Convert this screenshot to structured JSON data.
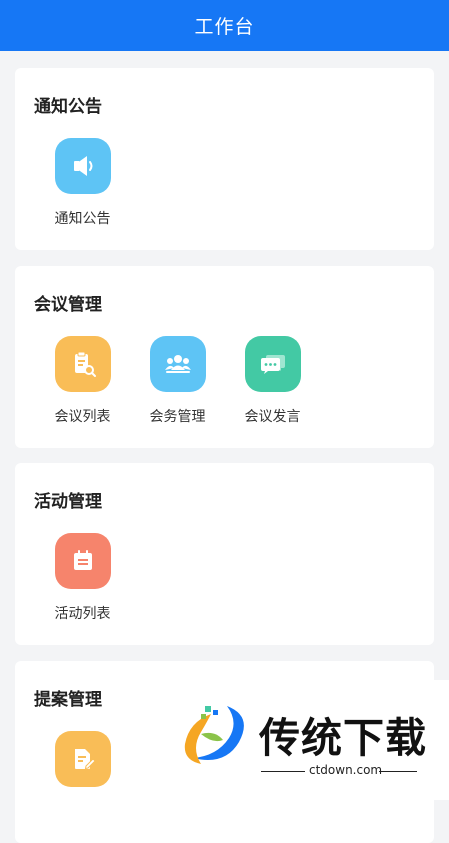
{
  "header": {
    "title": "工作台"
  },
  "sections": [
    {
      "title": "通知公告",
      "items": [
        {
          "label": "通知公告",
          "icon": "speaker-icon",
          "color": "#5ec4f5"
        }
      ]
    },
    {
      "title": "会议管理",
      "items": [
        {
          "label": "会议列表",
          "icon": "clipboard-search-icon",
          "color": "#f9bd57"
        },
        {
          "label": "会务管理",
          "icon": "group-icon",
          "color": "#5ec4f5"
        },
        {
          "label": "会议发言",
          "icon": "chat-bubble-icon",
          "color": "#43c9a4"
        }
      ]
    },
    {
      "title": "活动管理",
      "items": [
        {
          "label": "活动列表",
          "icon": "calendar-icon",
          "color": "#f6846c"
        }
      ]
    },
    {
      "title": "提案管理",
      "items": [
        {
          "label": "",
          "icon": "document-edit-icon",
          "color": "#f9bd57"
        }
      ]
    }
  ],
  "watermark": {
    "brand": "传统下载",
    "url": "ctdown.com",
    "logo_icon": "ctdown-logo-icon"
  }
}
